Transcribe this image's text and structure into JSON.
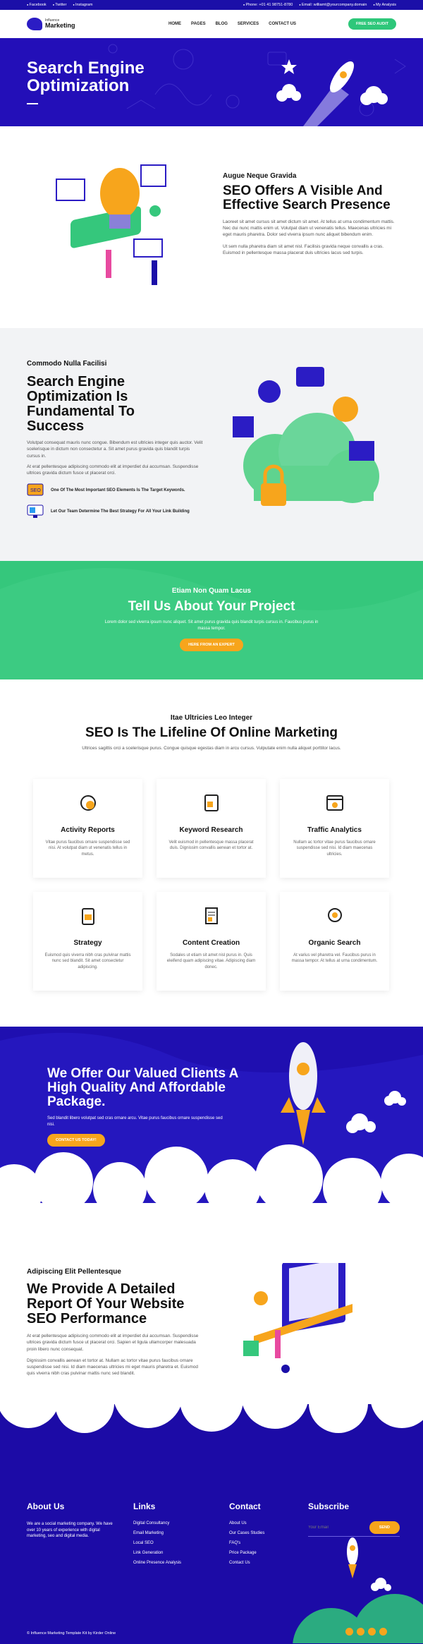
{
  "topbar": {
    "social": [
      "Facebook",
      "Twitter",
      "Instagram"
    ],
    "phone": "Phone: +01 41 98751-8780",
    "email": "Email: williamt@yourcompany.domain",
    "account": "My Analysis"
  },
  "nav": {
    "logo_line1": "Influence",
    "logo_line2": "Marketing",
    "items": [
      "HOME",
      "PAGES",
      "BLOG",
      "SERVICES",
      "CONTACT US"
    ],
    "cta": "FREE SEO AUDIT"
  },
  "hero": {
    "title_line1": "Search Engine",
    "title_line2": "Optimization"
  },
  "intro": {
    "eyebrow": "Augue Neque Gravida",
    "title": "SEO Offers A Visible And Effective Search Presence",
    "p1": "Laoreet sit amet cursus sit amet dictum sit amet. At tellus at urna condimentum mattis. Nec dui nunc mattis enim ut. Volutpat diam ut venenatis tellus. Maecenas ultricies mi eget mauris pharetra. Dolor sed viverra ipsum nunc aliquet bibendum enim.",
    "p2": "Ut sem nulla pharetra diam sit amet nisl. Facilisis gravida neque convallis a cras. Euismod in pellentesque massa placerat duis ultricies lacus sed turpis."
  },
  "fundamental": {
    "eyebrow": "Commodo Nulla Facilisi",
    "title": "Search Engine Optimization Is Fundamental To Success",
    "p1": "Volutpat consequat mauris nunc congue. Bibendum est ultricies integer quis auctor. Velit scelerisque in dictum non consectetur a. Sit amet purus gravida quis blandit turpis cursus in.",
    "p2": "At erat pellentesque adipiscing commodo elit at imperdiet dui accumsan. Suspendisse ultrices gravida dictum fusce ut placerat orci.",
    "points": [
      {
        "icon": "seo-badge-icon",
        "text": "One Of The Most Important SEO Elements Is The Target Keywords."
      },
      {
        "icon": "monitor-strategy-icon",
        "text": "Let Our Team Determine The Best Strategy For All Your Link Building"
      }
    ]
  },
  "cta": {
    "eyebrow": "Etiam Non Quam Lacus",
    "title": "Tell Us About Your Project",
    "text": "Lorem dolor sed viverra ipsum nunc aliquet. Sit amet purus gravida quis blandit turpis cursus in. Faucibus purus in massa tempor.",
    "button": "HERE FROM AN EXPERT"
  },
  "services": {
    "eyebrow": "Itae Ultricies Leo Integer",
    "title": "SEO Is The Lifeline Of Online Marketing",
    "text": "Ultrices sagittis orci a scelerisque purus. Congue quisque egestas diam in arcu cursus. Vulputate enim nulla aliquet porttitor lacus.",
    "cards": [
      {
        "icon": "gear-chart-icon",
        "title": "Activity Reports",
        "text": "Vitae purus faucibus ornare suspendisse sed nisi. At volutpat diam ut venenatis tellus in metus."
      },
      {
        "icon": "tablet-search-icon",
        "title": "Keyword Research",
        "text": "Velit euismod in pellentesque massa placerat duis. Dignissim convallis aenean et tortor at."
      },
      {
        "icon": "browser-analytics-icon",
        "title": "Traffic Analytics",
        "text": "Nullam ac tortor vitae purus faucibus ornare suspendisse sed nisi. Id diam maecenas ultricies."
      },
      {
        "icon": "clipboard-strategy-icon",
        "title": "Strategy",
        "text": "Euismod quis viverra nibh cras pulvinar mattis nunc sed blandit. Sit amet consectetur adipiscing."
      },
      {
        "icon": "document-content-icon",
        "title": "Content Creation",
        "text": "Sodales ut etiam sit amet nisl purus in. Quis eleifend quam adipiscing vitae. Adipiscing diam donec."
      },
      {
        "icon": "gear-search-icon",
        "title": "Organic Search",
        "text": "At varius vel pharetra vel. Faucibus purus in massa tempor. At tellus at urna condimentum."
      }
    ]
  },
  "offer": {
    "title": "We Offer Our Valued Clients A High Quality And Affordable Package.",
    "text": "Sed blandit libero volutpat sed cras ornare arcu. Vitae purus faucibus ornare suspendisse sed nisi.",
    "button": "CONTACT US TODAY!"
  },
  "detail": {
    "eyebrow": "Adipiscing Elit Pellentesque",
    "title": "We Provide A Detailed Report Of Your Website SEO Performance",
    "p1": "At erat pellentesque adipiscing commodo elit at imperdiet dui accumsan. Suspendisse ultrices gravida dictum fusce ut placerat orci. Sapien et ligula ullamcorper malesuada proin libero nunc consequat.",
    "p2": "Dignissim convallis aenean et tortor at. Nullam ac tortor vitae purus faucibus ornare suspendisse sed nisi. Id diam maecenas ultricies mi eget mauris pharetra et. Euismod quis viverra nibh cras pulvinar mattis nunc sed blandit."
  },
  "footer": {
    "about_title": "About Us",
    "about_text": "We are a social marketing company. We have over 10 years of experience with digital marketing, seo and digital media.",
    "links_title": "Links",
    "links": [
      "Digital Consultancy",
      "Email Marketing",
      "Local SEO",
      "Link Generation",
      "Online Presence Analysis"
    ],
    "contact_title": "Contact",
    "contact_links": [
      "About Us",
      "Our Cases Studies",
      "FAQ's",
      "Price Package",
      "Contact Us"
    ],
    "subscribe_title": "Subscribe",
    "email_placeholder": "Your Email",
    "subscribe_button": "SEND",
    "copyright": "© Influence Marketing Template Kit by Kirder Online",
    "social_icons": [
      "facebook-icon",
      "twitter-icon",
      "instagram-icon",
      "youtube-icon"
    ]
  },
  "colors": {
    "brand_blue": "#230fb8",
    "green": "#35c77c",
    "orange": "#f7a51c"
  }
}
